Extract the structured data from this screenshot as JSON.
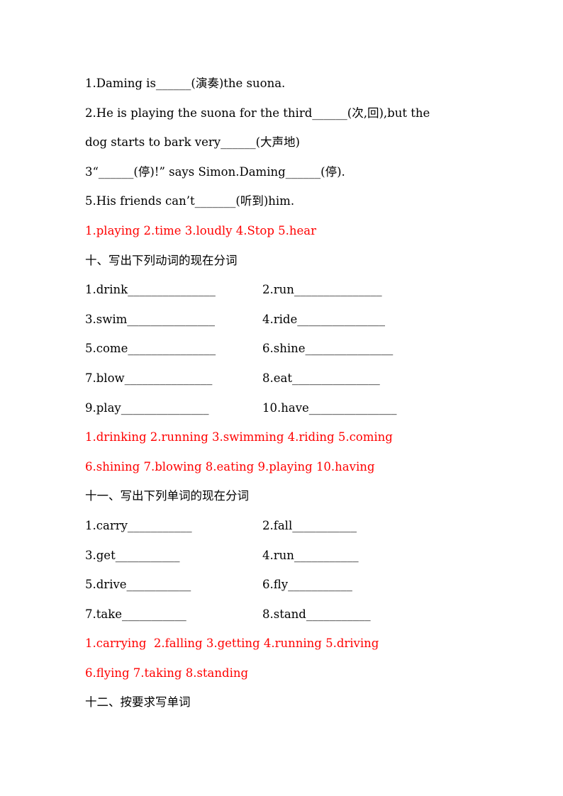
{
  "section9": {
    "questions": [
      "1.Daming is______(演奏)the suona.",
      "2.He is playing the suona for the third______(次,回),but the",
      "dog starts to bark very______(大声地)",
      "3“______(停)!” says Simon.Daming______(停).",
      "5.His friends can’t_______(听到)him."
    ],
    "answer": "1.playing 2.time 3.loudly 4.Stop 5.hear"
  },
  "section10": {
    "heading": "十、写出下列动词的现在分词",
    "rows": [
      [
        "1.drink_______________",
        "2.run_______________"
      ],
      [
        "3.swim_______________",
        "4.ride_______________"
      ],
      [
        "5.come_______________",
        "6.shine_______________"
      ],
      [
        "7.blow_______________",
        "8.eat_______________"
      ],
      [
        "9.play_______________",
        "10.have_______________"
      ]
    ],
    "answers": [
      "1.drinking 2.running 3.swimming 4.riding 5.coming",
      "6.shining 7.blowing 8.eating 9.playing 10.having"
    ]
  },
  "section11": {
    "heading": "十一、写出下列单词的现在分词",
    "rows": [
      [
        "1.carry___________",
        "2.fall___________"
      ],
      [
        "3.get___________",
        "4.run___________"
      ],
      [
        "5.drive___________",
        "6.fly___________"
      ],
      [
        "7.take___________",
        "8.stand___________"
      ]
    ],
    "answers": [
      "1.carrying  2.falling 3.getting 4.running 5.driving",
      "6.flying 7.taking 8.standing"
    ]
  },
  "section12": {
    "heading": "十二、按要求写单词"
  },
  "colors": {
    "text": "#000000",
    "answer": "#ff0000"
  }
}
